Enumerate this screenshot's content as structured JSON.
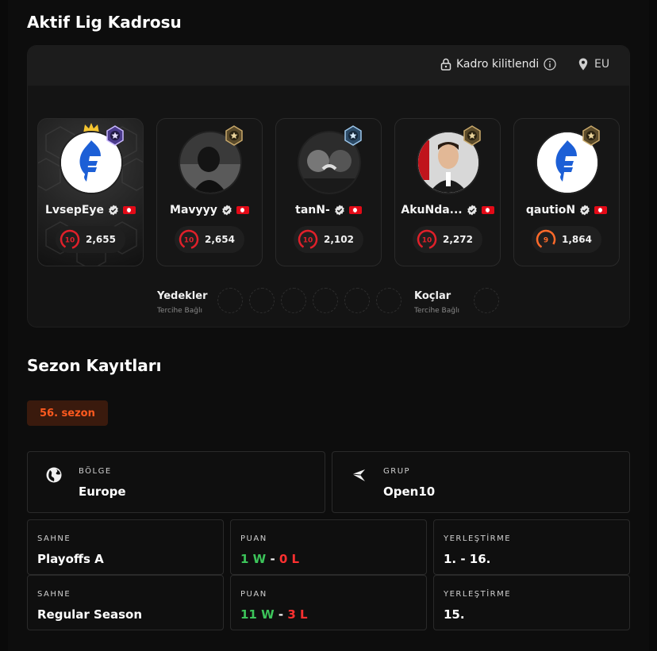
{
  "roster": {
    "title": "Aktif Lig Kadrosu",
    "lock_text": "Kadro kilitlendi",
    "region": "EU",
    "players": [
      {
        "name": "LvsepEye",
        "elo": "2,655",
        "level": "10",
        "captain": true
      },
      {
        "name": "Mavyyy",
        "elo": "2,654",
        "level": "10",
        "captain": false
      },
      {
        "name": "tanN-",
        "elo": "2,102",
        "level": "10",
        "captain": false
      },
      {
        "name": "AkuNda...",
        "elo": "2,272",
        "level": "10",
        "captain": false
      },
      {
        "name": "qautioN",
        "elo": "1,864",
        "level": "9",
        "captain": false
      }
    ],
    "substitutes_label": "Yedekler",
    "substitutes_hint": "Tercihe Bağlı",
    "coaches_label": "Koçlar",
    "coaches_hint": "Tercihe Bağlı"
  },
  "season": {
    "title": "Sezon Kayıtları",
    "badge": "56. sezon",
    "region_label": "BÖLGE",
    "region_value": "Europe",
    "group_label": "GRUP",
    "group_value": "Open10",
    "stages": [
      {
        "stage_label": "SAHNE",
        "stage": "Playoffs A",
        "score_label": "PUAN",
        "wins": "1 W",
        "losses": "0 L",
        "place_label": "YERLEŞTİRME",
        "place": "1. - 16."
      },
      {
        "stage_label": "SAHNE",
        "stage": "Regular Season",
        "score_label": "PUAN",
        "wins": "11 W",
        "losses": "3 L",
        "place_label": "YERLEŞTİRME",
        "place": "15."
      }
    ]
  },
  "colors": {
    "accent_orange": "#ff5a1f",
    "win_green": "#3cc45a",
    "loss_red": "#ff3030",
    "level10_red": "#e0202a",
    "level9_orange": "#ff6a2a"
  },
  "icons": [
    "lock-icon",
    "info-icon",
    "location-pin-icon",
    "globe-icon",
    "bracket-icon",
    "verified-icon",
    "turkey-flag-icon",
    "crown-icon",
    "level-badge-icon"
  ]
}
